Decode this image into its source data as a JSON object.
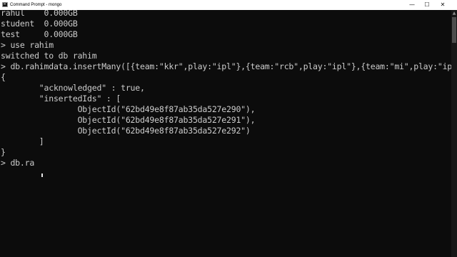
{
  "window": {
    "title": "Command Prompt - mongo",
    "controls": {
      "minimize": "—",
      "maximize": "☐",
      "close": "✕"
    }
  },
  "terminal": {
    "lines": [
      "rahul    0.000GB",
      "student  0.000GB",
      "test     0.000GB",
      "> use rahim",
      "switched to db rahim",
      "> db.rahimdata.insertMany([{team:\"kkr\",play:\"ipl\"},{team:\"rcb\",play:\"ipl\"},{team:\"mi\",play:\"ipl\"}])",
      "{",
      "        \"acknowledged\" : true,",
      "        \"insertedIds\" : [",
      "                ObjectId(\"62bd49e8f87ab35da527e290\"),",
      "                ObjectId(\"62bd49e8f87ab35da527e291\"),",
      "                ObjectId(\"62bd49e8f87ab35da527e292\")",
      "        ]",
      "}",
      "> db.ra"
    ]
  },
  "scrollbar": {
    "up_arrow": "▲"
  }
}
